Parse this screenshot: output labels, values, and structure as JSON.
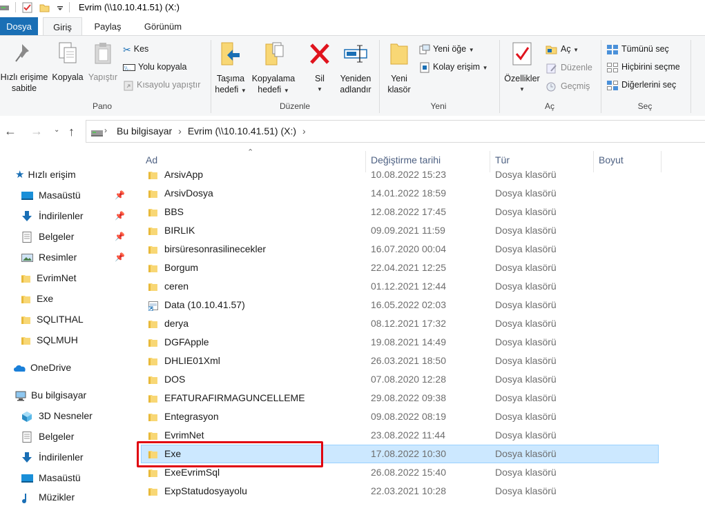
{
  "window": {
    "title": "Evrim (\\\\10.10.41.51) (X:)"
  },
  "tabs": {
    "file": "Dosya",
    "home": "Giriş",
    "share": "Paylaş",
    "view": "Görünüm"
  },
  "ribbon": {
    "pano": {
      "label": "Pano",
      "pin_line1": "Hızlı erişime",
      "pin_line2": "sabitle",
      "copy": "Kopyala",
      "paste": "Yapıştır",
      "cut": "Kes",
      "copy_path": "Yolu kopyala",
      "paste_shortcut": "Kısayolu yapıştır"
    },
    "duzenle": {
      "label": "Düzenle",
      "move_line1": "Taşıma",
      "move_line2": "hedefi",
      "copyto_line1": "Kopyalama",
      "copyto_line2": "hedefi",
      "delete": "Sil",
      "rename_line1": "Yeniden",
      "rename_line2": "adlandır"
    },
    "yeni": {
      "label": "Yeni",
      "folder_line1": "Yeni",
      "folder_line2": "klasör",
      "new_item": "Yeni öğe",
      "easy_access": "Kolay erişim"
    },
    "ac": {
      "label": "Aç",
      "properties": "Özellikler",
      "open": "Aç",
      "edit": "Düzenle",
      "history": "Geçmiş"
    },
    "sec": {
      "label": "Seç",
      "select_all": "Tümünü seç",
      "select_none": "Hiçbirini seçme",
      "invert": "Diğerlerini seç"
    }
  },
  "address": {
    "crumb1": "Bu bilgisayar",
    "crumb2": "Evrim (\\\\10.10.41.51) (X:)"
  },
  "nav": {
    "quick_access": "Hızlı erişim",
    "qa_items": [
      "Masaüstü",
      "İndirilenler",
      "Belgeler",
      "Resimler",
      "EvrimNet",
      "Exe",
      "SQLITHAL",
      "SQLMUH"
    ],
    "onedrive": "OneDrive",
    "this_pc": "Bu bilgisayar",
    "pc_items": [
      "3D Nesneler",
      "Belgeler",
      "İndirilenler",
      "Masaüstü",
      "Müzikler"
    ]
  },
  "columns": {
    "name": "Ad",
    "date": "Değiştirme tarihi",
    "type": "Tür",
    "size": "Boyut"
  },
  "files": [
    {
      "name": "ArsivApp",
      "date": "10.08.2022 15:23",
      "type": "Dosya klasörü"
    },
    {
      "name": "ArsivDosya",
      "date": "14.01.2022 18:59",
      "type": "Dosya klasörü"
    },
    {
      "name": "BBS",
      "date": "12.08.2022 17:45",
      "type": "Dosya klasörü"
    },
    {
      "name": "BIRLIK",
      "date": "09.09.2021 11:59",
      "type": "Dosya klasörü"
    },
    {
      "name": "birsüresonrasilinecekler",
      "date": "16.07.2020 00:04",
      "type": "Dosya klasörü"
    },
    {
      "name": "Borgum",
      "date": "22.04.2021 12:25",
      "type": "Dosya klasörü"
    },
    {
      "name": "ceren",
      "date": "01.12.2021 12:44",
      "type": "Dosya klasörü"
    },
    {
      "name": "Data (10.10.41.57)",
      "date": "16.05.2022 02:03",
      "type": "Dosya klasörü"
    },
    {
      "name": "derya",
      "date": "08.12.2021 17:32",
      "type": "Dosya klasörü"
    },
    {
      "name": "DGFApple",
      "date": "19.08.2021 14:49",
      "type": "Dosya klasörü"
    },
    {
      "name": "DHLIE01Xml",
      "date": "26.03.2021 18:50",
      "type": "Dosya klasörü"
    },
    {
      "name": "DOS",
      "date": "07.08.2020 12:28",
      "type": "Dosya klasörü"
    },
    {
      "name": "EFATURAFIRMAGUNCELLEME",
      "date": "29.08.2022 09:38",
      "type": "Dosya klasörü"
    },
    {
      "name": "Entegrasyon",
      "date": "09.08.2022 08:19",
      "type": "Dosya klasörü"
    },
    {
      "name": "EvrimNet",
      "date": "23.08.2022 11:44",
      "type": "Dosya klasörü"
    },
    {
      "name": "Exe",
      "date": "17.08.2022 10:30",
      "type": "Dosya klasörü"
    },
    {
      "name": "ExeEvrimSql",
      "date": "26.08.2022 15:40",
      "type": "Dosya klasörü"
    },
    {
      "name": "ExpStatudosyayolu",
      "date": "22.03.2021 10:28",
      "type": "Dosya klasörü"
    }
  ],
  "selected_file": "Exe",
  "colors": {
    "accent": "#1a6fb5",
    "selection": "#cce8ff",
    "highlight_box": "#e0000f",
    "folder": "#f8d775"
  }
}
